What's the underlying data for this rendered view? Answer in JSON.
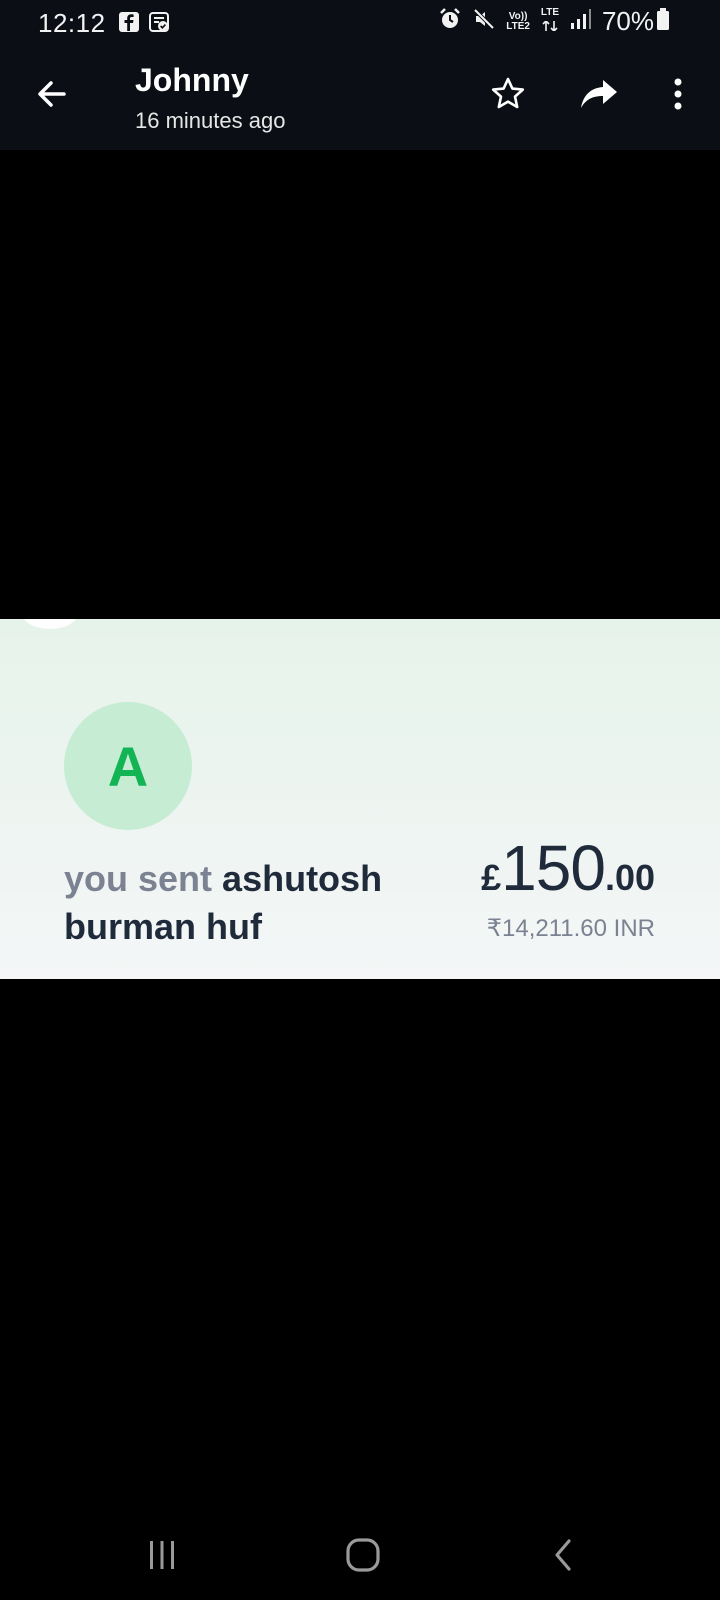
{
  "status_bar": {
    "time": "12:12",
    "notification_icons": [
      "facebook-icon",
      "clipboard-check-icon"
    ],
    "right_icons": [
      "alarm-icon",
      "mute-icon",
      "volte-lte2-icon",
      "lte-data-icon",
      "signal-icon",
      "battery-icon"
    ],
    "volte_label_top": "Vo))",
    "volte_label_bottom": "LTE2",
    "lte_label": "LTE",
    "battery_percent": "70%"
  },
  "app_bar": {
    "contact_name": "Johnny",
    "timestamp": "16 minutes ago",
    "actions": [
      "star-icon",
      "share-icon",
      "more-vertical-icon"
    ]
  },
  "payment": {
    "avatar_letter": "A",
    "prefix": "you sent",
    "recipient": "ashutosh burman huf",
    "currency_symbol": "£",
    "amount_whole": "150",
    "amount_decimal": ".00",
    "converted": "₹14,211.60 INR"
  },
  "colors": {
    "app_bar_bg": "#0b0f15",
    "avatar_bg": "#c6ecd4",
    "avatar_letter": "#13b454",
    "text_dark": "#1f2a3a",
    "text_muted": "#7b8291"
  },
  "nav_bar": {
    "buttons": [
      "recents-icon",
      "home-icon",
      "back-icon"
    ]
  }
}
